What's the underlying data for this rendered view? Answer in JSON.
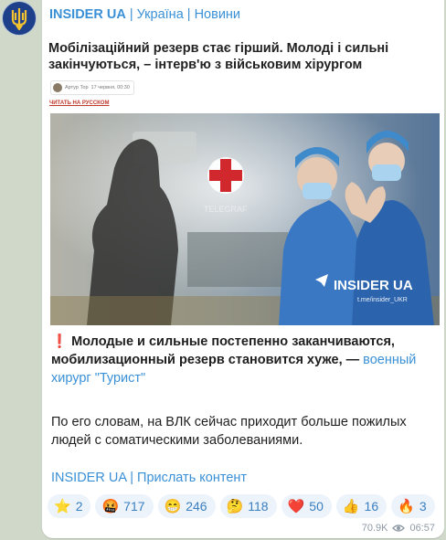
{
  "channel": {
    "name": "INSIDER UA",
    "suffix": " | Україна | Новини"
  },
  "article": {
    "title": "Мобілізаційний резерв стає гірший. Молоді і сильні закінчуються, – інтерв'ю з військовим хірургом",
    "author": "Артур Тор",
    "date": "17 червня, 00:30",
    "ru_link": "ЧИТАТЬ НА РУССКОМ",
    "photo_watermark": "TELEGRAF",
    "photo_brand": "INSIDER UA",
    "photo_handle": "t.me/insider_UKR"
  },
  "message": {
    "emoji": "❗",
    "lead_bold": "Молодые и сильные постепенно заканчиваются, мобилизационный резерв становится хуже, —",
    "lead_link": "военный хирург \"Турист\"",
    "para2": "По его словам, на ВЛК сейчас приходит больше пожилых людей с соматическими заболеваниями."
  },
  "footer": {
    "link1": "INSIDER UA",
    "separator": " | ",
    "link2": "Прислать контент"
  },
  "reactions": [
    {
      "emoji": "⭐",
      "count": "2"
    },
    {
      "emoji": "🤬",
      "count": "717"
    },
    {
      "emoji": "😁",
      "count": "246"
    },
    {
      "emoji": "🤔",
      "count": "118"
    },
    {
      "emoji": "❤️",
      "count": "50"
    },
    {
      "emoji": "👍",
      "count": "16"
    },
    {
      "emoji": "🔥",
      "count": "3"
    }
  ],
  "meta": {
    "views": "70.9K",
    "time": "06:57"
  },
  "colors": {
    "accent": "#3a90d6",
    "background": "#cfd8c9",
    "bubble": "#ffffff"
  }
}
